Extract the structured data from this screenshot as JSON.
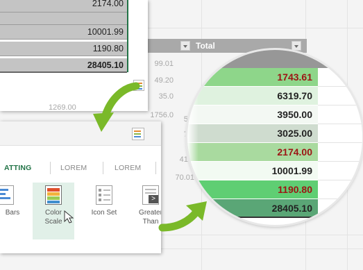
{
  "background_table": {
    "header_label": "Total",
    "partial_values": [
      "99.01",
      "49.20",
      "35.0",
      "56.",
      "73.",
      "41.8",
      "70.01"
    ],
    "left_cell_values": [
      "1269.00",
      "1756.0"
    ]
  },
  "top_panel": {
    "cells": [
      "2174.00",
      "10001.99",
      "1190.80",
      "28405.10"
    ]
  },
  "ribbon": {
    "tabs": [
      "ATTING",
      "LOREM",
      "LOREM"
    ],
    "tiles": [
      {
        "label": "Bars",
        "icon": "data-bars-icon"
      },
      {
        "label": "Color\nScale",
        "icon": "color-scale-icon"
      },
      {
        "label": "Icon Set",
        "icon": "icon-set-icon"
      },
      {
        "label": "Greater\nThan",
        "icon": "greater-than-icon"
      }
    ],
    "active_tab_color": "#217346",
    "selected_tile_color": "#e1f0e8"
  },
  "magnified_cells": [
    {
      "value": "1743.61",
      "bg": "#8ed68a",
      "style": "red"
    },
    {
      "value": "6319.70",
      "bg": "#dff2df",
      "style": "dark"
    },
    {
      "value": "3950.00",
      "bg": "#f3f8f3",
      "style": "dark"
    },
    {
      "value": "3025.00",
      "bg": "#cfdccf",
      "style": "dark"
    },
    {
      "value": "2174.00",
      "bg": "#a9da9f",
      "style": "red"
    },
    {
      "value": "10001.99",
      "bg": "#f2faf2",
      "style": "dark"
    },
    {
      "value": "1190.80",
      "bg": "#5fce73",
      "style": "red"
    },
    {
      "value": "28405.10",
      "bg": "#5aa676",
      "style": "dark"
    }
  ],
  "colors": {
    "excel_green": "#217346",
    "arrow_green": "#7ab929"
  }
}
